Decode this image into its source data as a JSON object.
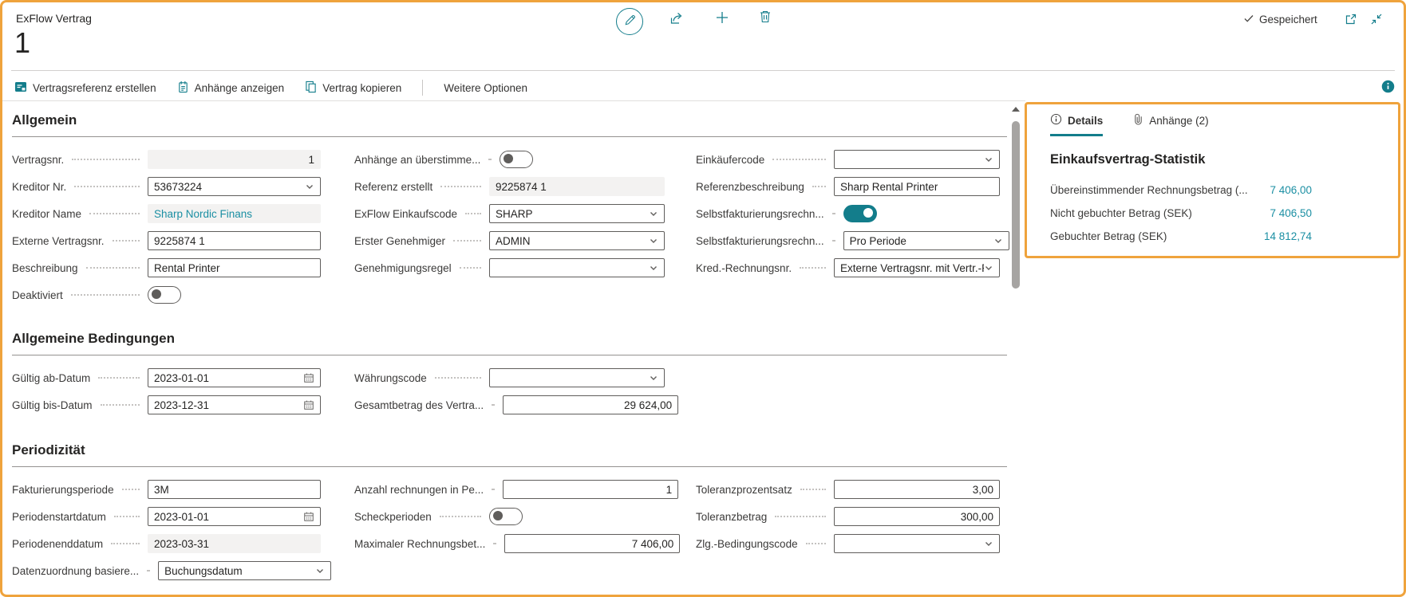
{
  "colors": {
    "accent": "#137d8b",
    "link": "#1b8fa3",
    "highlight": "#efa33c"
  },
  "header": {
    "caption": "ExFlow Vertrag",
    "title": "1",
    "saved_status": "Gespeichert",
    "toolbar_icons": [
      "edit",
      "share",
      "add",
      "delete"
    ],
    "window_icons": [
      "open-in-new-window",
      "collapse"
    ]
  },
  "action_bar": {
    "items": [
      {
        "label": "Vertragsreferenz erstellen",
        "icon": "create-reference-icon"
      },
      {
        "label": "Anhänge anzeigen",
        "icon": "show-attachments-icon"
      },
      {
        "label": "Vertrag kopieren",
        "icon": "copy-contract-icon"
      }
    ],
    "more_label": "Weitere Optionen",
    "info_icon": "info-icon"
  },
  "sections": [
    {
      "title": "Allgemein",
      "columns": [
        [
          {
            "name": "vertragsnr",
            "label": "Vertragsnr.",
            "type": "readonly",
            "value": "1",
            "align": "right"
          },
          {
            "name": "kreditor-nr",
            "label": "Kreditor Nr.",
            "type": "combo",
            "value": "53673224"
          },
          {
            "name": "kreditor-name",
            "label": "Kreditor Name",
            "type": "readonly",
            "value": "Sharp Nordic Finans",
            "link": true
          },
          {
            "name": "externe-vertragsnr",
            "label": "Externe Vertragsnr.",
            "type": "input",
            "value": "9225874 1"
          },
          {
            "name": "beschreibung",
            "label": "Beschreibung",
            "type": "input",
            "value": "Rental Printer"
          },
          {
            "name": "deaktiviert",
            "label": "Deaktiviert",
            "type": "toggle",
            "state": "off"
          }
        ],
        [
          {
            "name": "anhaenge-an-ueberstimmende",
            "label": "Anhänge an überstimme...",
            "type": "toggle",
            "state": "off"
          },
          {
            "name": "referenz-erstellt",
            "label": "Referenz erstellt",
            "type": "readonly",
            "value": "9225874 1"
          },
          {
            "name": "exflow-einkaufscode",
            "label": "ExFlow Einkaufscode",
            "type": "combo",
            "value": "SHARP"
          },
          {
            "name": "erster-genehmiger",
            "label": "Erster Genehmiger",
            "type": "combo",
            "value": "ADMIN"
          },
          {
            "name": "genehmigungsregel",
            "label": "Genehmigungsregel",
            "type": "combo",
            "value": ""
          }
        ],
        [
          {
            "name": "einkaeufercode",
            "label": "Einkäufercode",
            "type": "combo",
            "value": ""
          },
          {
            "name": "referenzbeschreibung",
            "label": "Referenzbeschreibung",
            "type": "input",
            "value": "Sharp Rental Printer"
          },
          {
            "name": "selbstfakturierungsrechnung",
            "label": "Selbstfakturierungsrechn...",
            "type": "toggle",
            "state": "on"
          },
          {
            "name": "selbstfakturierungsrechnung-periode",
            "label": "Selbstfakturierungsrechn...",
            "type": "combo",
            "value": "Pro Periode"
          },
          {
            "name": "kred-rechnungsnr",
            "label": "Kred.-Rechnungsnr.",
            "type": "combo",
            "value": "Externe Vertragsnr. mit Vertr.-Perioc"
          }
        ]
      ]
    },
    {
      "title": "Allgemeine Bedingungen",
      "columns": [
        [
          {
            "name": "gueltig-ab-datum",
            "label": "Gültig ab-Datum",
            "type": "date",
            "value": "2023-01-01"
          },
          {
            "name": "gueltig-bis-datum",
            "label": "Gültig bis-Datum",
            "type": "date",
            "value": "2023-12-31"
          }
        ],
        [
          {
            "name": "waehrungscode",
            "label": "Währungscode",
            "type": "combo",
            "value": ""
          },
          {
            "name": "gesamtbetrag-des-vertrags",
            "label": "Gesamtbetrag des Vertra...",
            "type": "input",
            "value": "29 624,00",
            "align": "right"
          }
        ],
        []
      ]
    },
    {
      "title": "Periodizität",
      "columns": [
        [
          {
            "name": "fakturierungsperiode",
            "label": "Fakturierungsperiode",
            "type": "input",
            "value": "3M"
          },
          {
            "name": "periodenstartdatum",
            "label": "Periodenstartdatum",
            "type": "date",
            "value": "2023-01-01"
          },
          {
            "name": "periodenenddatum",
            "label": "Periodenenddatum",
            "type": "readonly",
            "value": "2023-03-31"
          },
          {
            "name": "datenzuordnung-basierend",
            "label": "Datenzuordnung basiere...",
            "type": "combo",
            "value": "Buchungsdatum"
          }
        ],
        [
          {
            "name": "anzahl-rechnungen-in-periode",
            "label": "Anzahl rechnungen in Pe...",
            "type": "input",
            "value": "1",
            "align": "right"
          },
          {
            "name": "scheckperioden",
            "label": "Scheckperioden",
            "type": "toggle",
            "state": "off"
          },
          {
            "name": "maximaler-rechnungsbetrag",
            "label": "Maximaler Rechnungsbet...",
            "type": "input",
            "value": "7 406,00",
            "align": "right"
          }
        ],
        [
          {
            "name": "toleranzprozentsatz",
            "label": "Toleranzprozentsatz",
            "type": "input",
            "value": "3,00",
            "align": "right"
          },
          {
            "name": "toleranzbetrag",
            "label": "Toleranzbetrag",
            "type": "input",
            "value": "300,00",
            "align": "right"
          },
          {
            "name": "zlg-bedingungscode",
            "label": "Zlg.-Bedingungscode",
            "type": "combo",
            "value": ""
          }
        ]
      ]
    }
  ],
  "factbox": {
    "tabs": [
      {
        "label": "Details",
        "icon": "info-icon",
        "active": true
      },
      {
        "label": "Anhänge (2)",
        "icon": "paperclip-icon",
        "active": false
      }
    ],
    "heading": "Einkaufsvertrag-Statistik",
    "stats": [
      {
        "label": "Übereinstimmender Rechnungsbetrag (...",
        "value": "7 406,00"
      },
      {
        "label": "Nicht gebuchter Betrag (SEK)",
        "value": "7 406,50"
      },
      {
        "label": "Gebuchter Betrag (SEK)",
        "value": "14 812,74"
      }
    ]
  }
}
